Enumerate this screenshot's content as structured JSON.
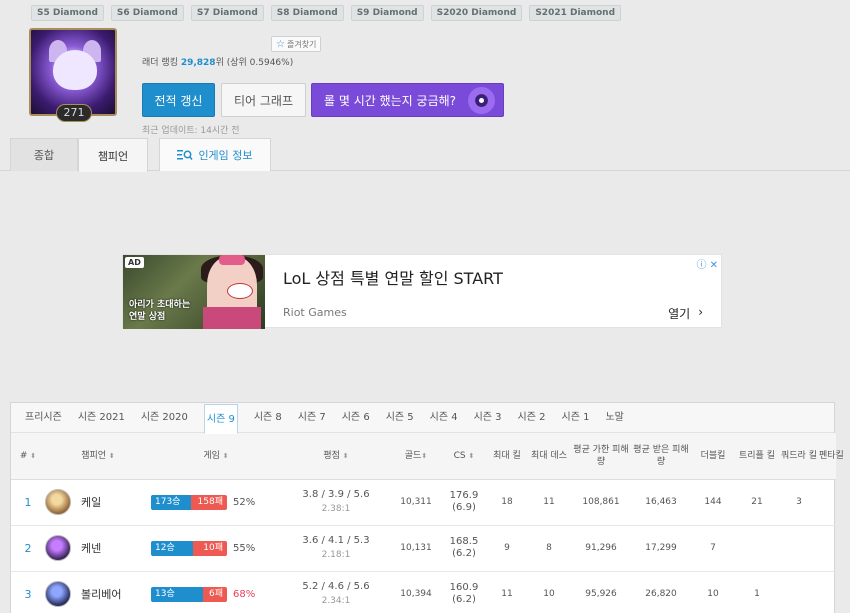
{
  "past_tiers": [
    "S5 Diamond",
    "S6 Diamond",
    "S7 Diamond",
    "S8 Diamond",
    "S9 Diamond",
    "S2020 Diamond",
    "S2021 Diamond"
  ],
  "profile": {
    "level": "271",
    "favorite_label": "즐겨찾기",
    "ladder_prefix": "래더 랭킹 ",
    "ladder_rank": "29,828",
    "ladder_suffix": "위 (상위 0.5946%)",
    "refresh_label": "전적 갱신",
    "tier_graph_label": "티어 그래프",
    "playtime_label": "롤 몇 시간 했는지 궁금해?",
    "updated": "최근 업데이트: 14시간 전"
  },
  "tabs": {
    "summary": "종합",
    "champions": "챔피언",
    "ingame": "인게임 정보"
  },
  "ad": {
    "badge": "AD",
    "caption": "아리가 초대하는\n연말 상점",
    "title": "LoL 상점 특별 연말 할인 START",
    "source": "Riot Games",
    "open_label": "열기",
    "chevron": "›",
    "info": "ⓘ ✕"
  },
  "seasons": [
    "프리시즌",
    "시즌 2021",
    "시즌 2020",
    "시즌 9",
    "시즌 8",
    "시즌 7",
    "시즌 6",
    "시즌 5",
    "시즌 4",
    "시즌 3",
    "시즌 2",
    "시즌 1",
    "노말"
  ],
  "active_season": "시즌 9",
  "headers": {
    "rank": "#",
    "champion": "챔피언",
    "games": "게임",
    "kda": "평점",
    "gold": "골드",
    "cs": "CS",
    "max_kills": "최대 킬",
    "max_deaths": "최대 데스",
    "dmg_dealt": "평균 가한 피해량",
    "dmg_taken": "평균 받은 피해량",
    "double": "더블킬",
    "triple": "트리플 킬",
    "quadra": "쿼드라 킬",
    "penta": "펜타킬"
  },
  "rows": [
    {
      "rank": "1",
      "champion": "케일",
      "wins": "173승",
      "losses": "158패",
      "win_fraction": 0.52,
      "winrate": "52%",
      "kda": "3.8 / 3.9 / 5.6",
      "ratio": "2.38:1",
      "gold": "10,311",
      "cs": "176.9",
      "cs_min": "(6.9)",
      "max_kills": "18",
      "max_deaths": "11",
      "dmg_dealt": "108,861",
      "dmg_taken": "16,463",
      "double": "144",
      "triple": "21",
      "quadra": "3",
      "penta": "",
      "hot": false,
      "icon_colors": [
        "#f3d9a0",
        "#8b5a2b"
      ]
    },
    {
      "rank": "2",
      "champion": "케넨",
      "wins": "12승",
      "losses": "10패",
      "win_fraction": 0.55,
      "winrate": "55%",
      "kda": "3.6 / 4.1 / 5.3",
      "ratio": "2.18:1",
      "gold": "10,131",
      "cs": "168.5",
      "cs_min": "(6.2)",
      "max_kills": "9",
      "max_deaths": "8",
      "dmg_dealt": "91,296",
      "dmg_taken": "17,299",
      "double": "7",
      "triple": "",
      "quadra": "",
      "penta": "",
      "hot": false,
      "icon_colors": [
        "#c77dff",
        "#2a1a4a"
      ]
    },
    {
      "rank": "3",
      "champion": "볼리베어",
      "wins": "13승",
      "losses": "6패",
      "win_fraction": 0.68,
      "winrate": "68%",
      "kda": "5.2 / 4.6 / 5.6",
      "ratio": "2.34:1",
      "gold": "10,394",
      "cs": "160.9",
      "cs_min": "(6.2)",
      "max_kills": "11",
      "max_deaths": "10",
      "dmg_dealt": "95,926",
      "dmg_taken": "26,820",
      "double": "10",
      "triple": "1",
      "quadra": "",
      "penta": "",
      "hot": true,
      "icon_colors": [
        "#8fa6ff",
        "#1b1f4a"
      ]
    }
  ]
}
